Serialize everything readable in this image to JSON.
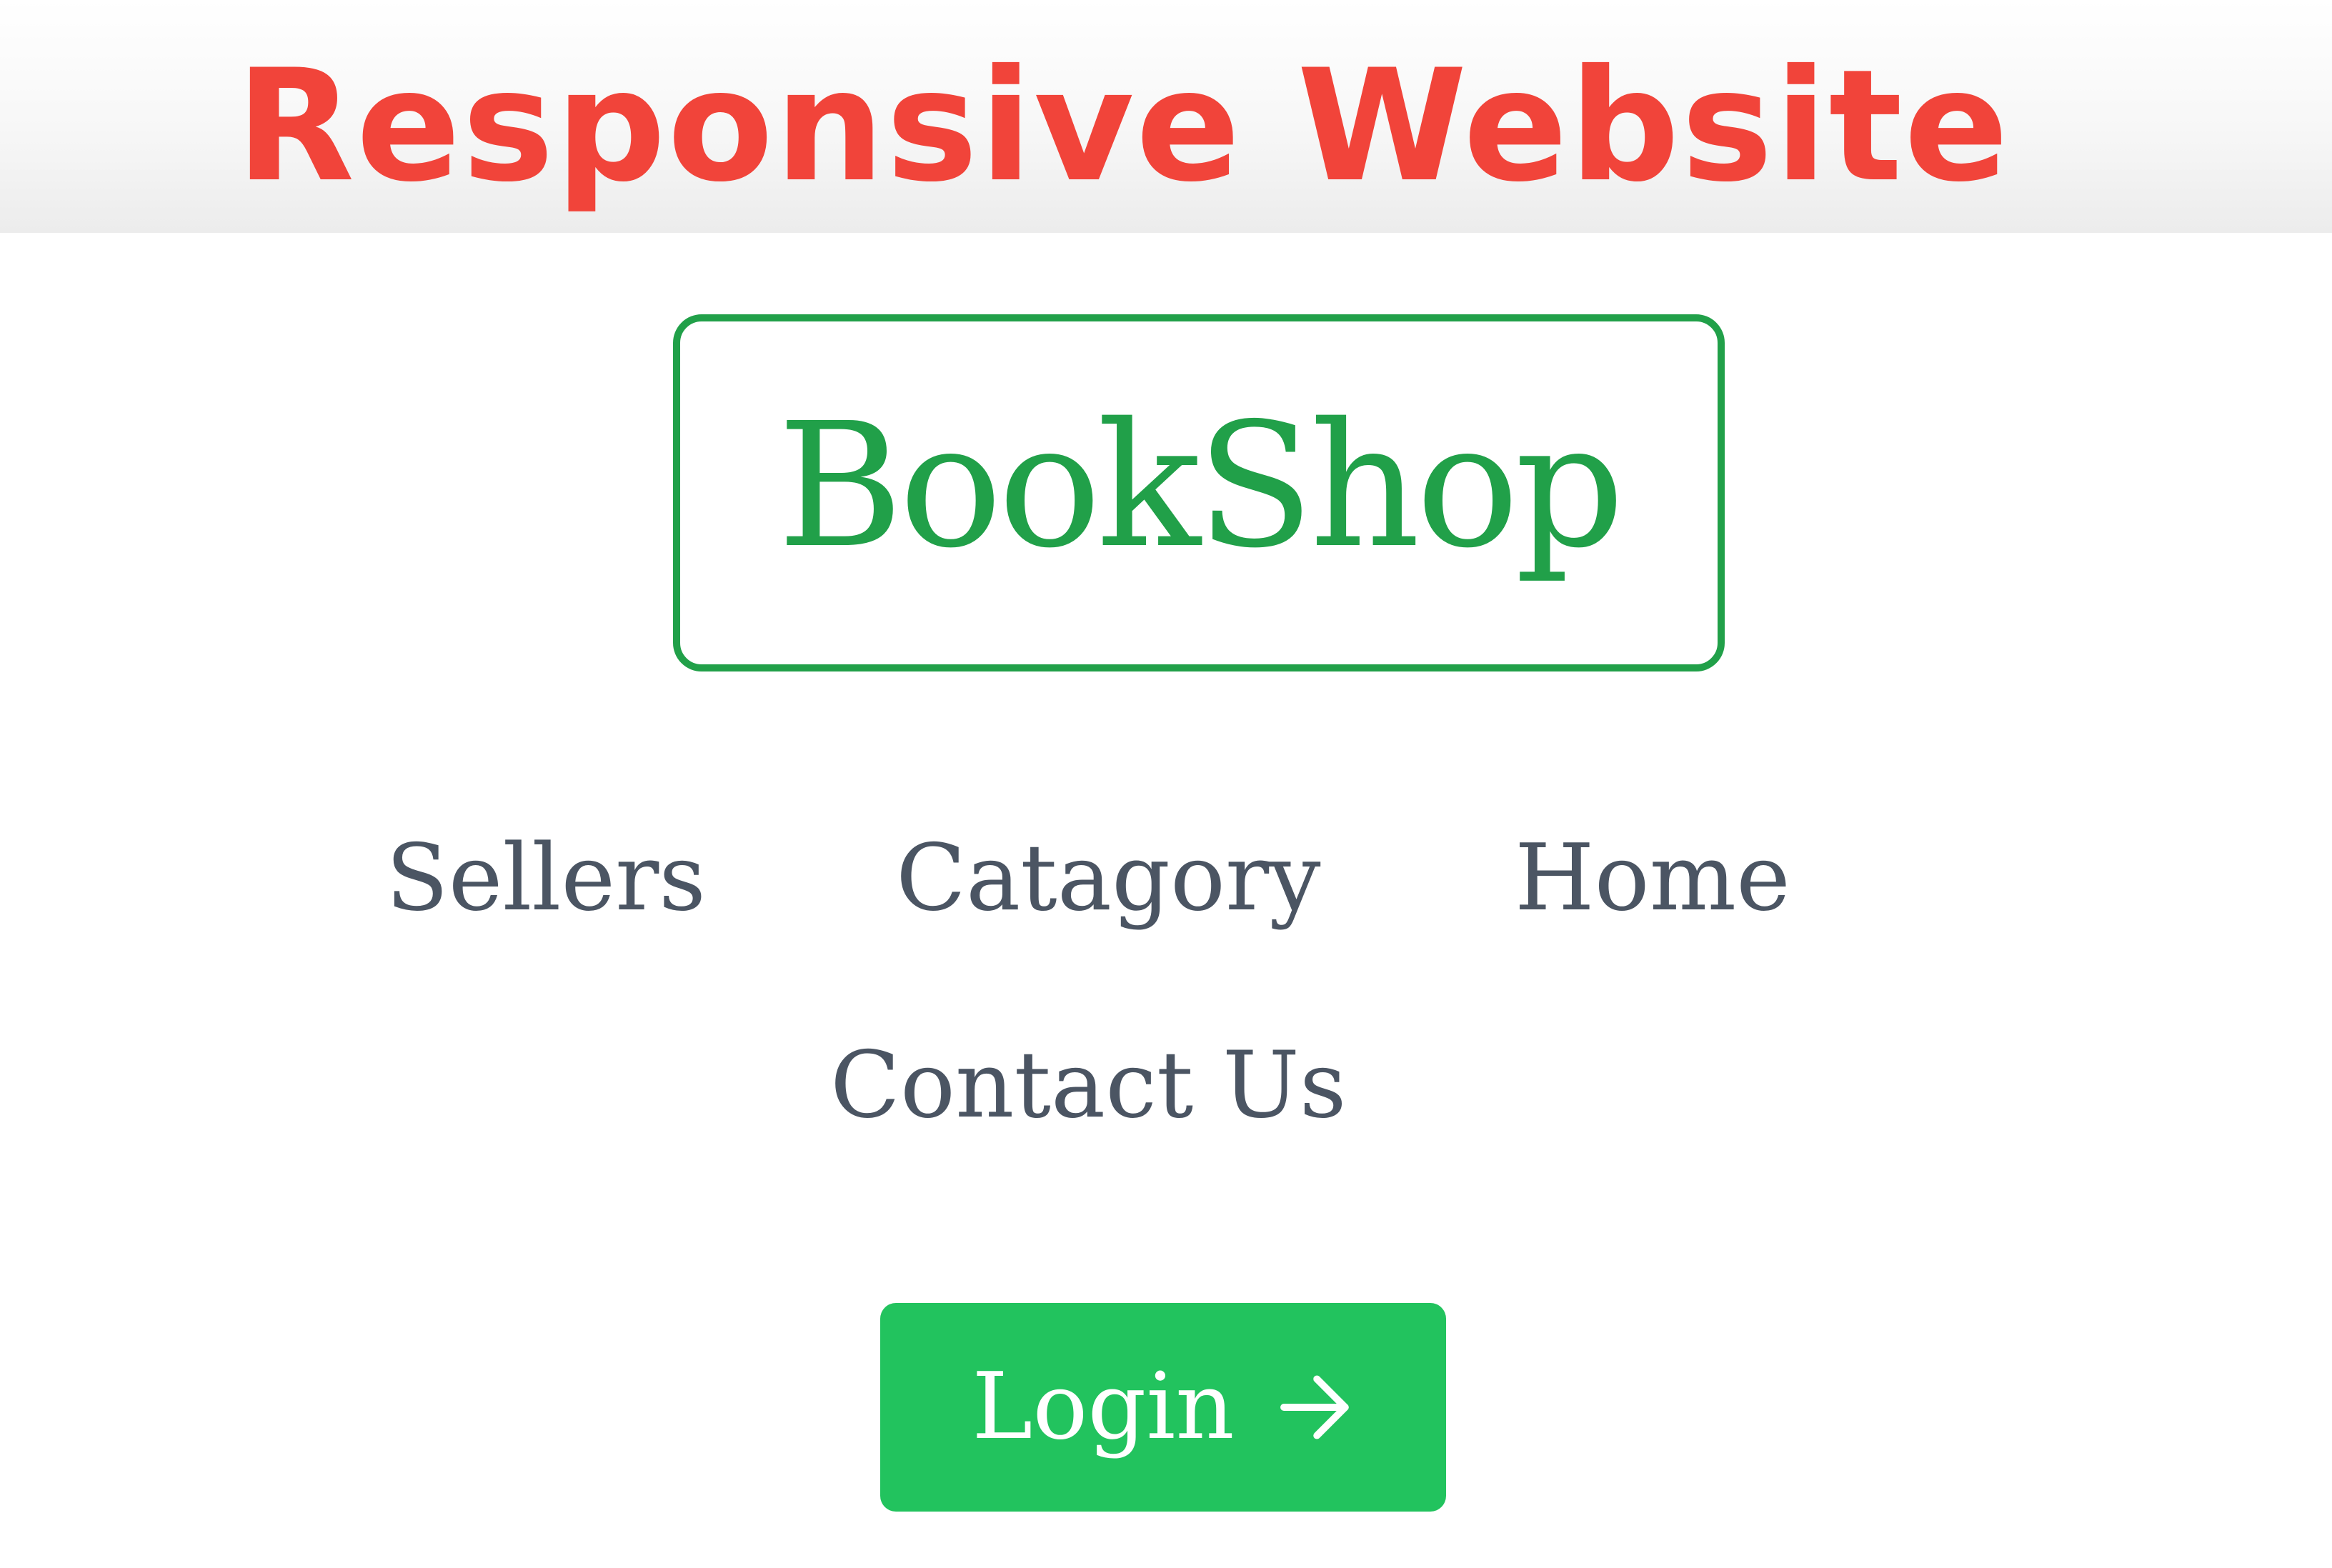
{
  "banner": {
    "title": "Responsive Website",
    "title_color": "#f1443a"
  },
  "header": {
    "logo_text": "BookShop",
    "logo_color": "#21a049"
  },
  "nav": {
    "items": [
      {
        "label": "Sellers"
      },
      {
        "label": "Catagory"
      },
      {
        "label": "Home"
      },
      {
        "label": "Contact Us"
      }
    ],
    "text_color": "#4b5563"
  },
  "login": {
    "label": "Login",
    "icon": "arrow-right-icon",
    "background_color": "#22c35e",
    "text_color": "#ffffff"
  }
}
